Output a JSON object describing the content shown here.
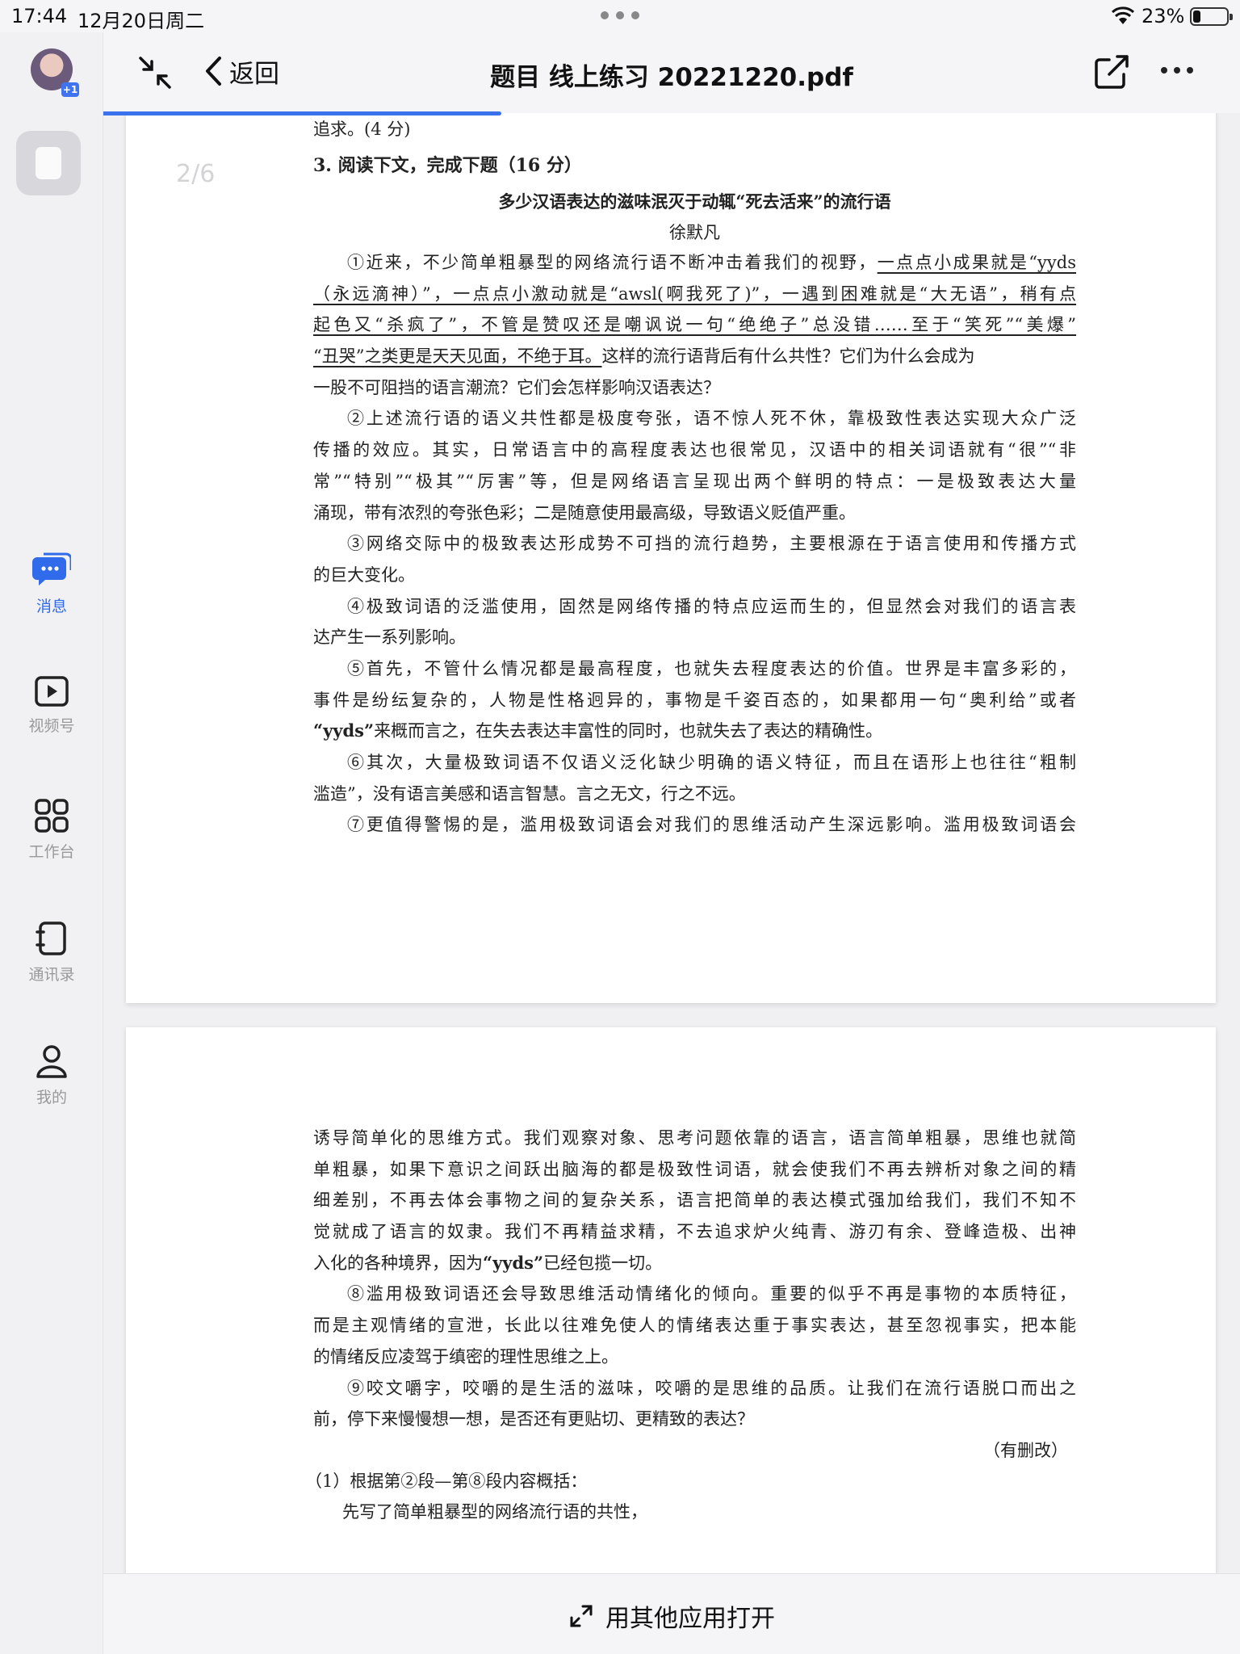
{
  "status_bar": {
    "time": "17:44",
    "date": "12月20日周二",
    "battery_percent": "23%",
    "battery_level": 0.23
  },
  "sidebar": {
    "avatar_badge": "+1",
    "items": [
      {
        "label": "消息",
        "icon": "chat-bubble-icon",
        "active": true
      },
      {
        "label": "视频号",
        "icon": "video-play-icon",
        "active": false
      },
      {
        "label": "工作台",
        "icon": "grid-apps-icon",
        "active": false
      },
      {
        "label": "通讯录",
        "icon": "contacts-book-icon",
        "active": false
      },
      {
        "label": "我的",
        "icon": "person-icon",
        "active": false
      }
    ]
  },
  "header": {
    "back_label": "返回",
    "title": "题目 线上练习 20221220.pdf"
  },
  "viewer": {
    "page_indicator": "2/6",
    "read_progress": 0.35
  },
  "document": {
    "prev_tail": "追求。(4 分)",
    "question_head": "3. 阅读下文，完成下题（16 分）",
    "article_title": "多少汉语表达的滋味泯灭于动辄“死去活来”的流行语",
    "author": "徐默凡",
    "p1": [
      "①近来，不少简单粗暴型的网络流行语不断冲击着我们的视野，",
      "一点点小成果就是“yyds",
      "（永远滴神）”，一点点小激动就是“awsl(啊我死了)”，一遇到困难就是“大无语”，稍有点",
      "起色又“杀疯了”，不管是赞叹还是嘲讽说一句“绝绝子”总没错……至于“笑死”“美爆”",
      "“丑哭”之类更是天天见面，不绝于耳。",
      "这样的流行语背后有什么共性？它们为什么会成为",
      "一股不可阻挡的语言潮流？它们会怎样影响汉语表达？"
    ],
    "p2": [
      "②上述流行语的语义共性都是极度夸张，语不惊人死不休，靠极致性表达实现大众广泛",
      "传播的效应。其实，日常语言中的高程度表达也很常见，汉语中的相关词语就有“很”“非",
      "常”“特别”“极其”“厉害”等，但是网络语言呈现出两个鲜明的特点：一是极致表达大量",
      "涌现，带有浓烈的夸张色彩；二是随意使用最高级，导致语义贬值严重。"
    ],
    "p3": [
      "③网络交际中的极致表达形成势不可挡的流行趋势，主要根源在于语言使用和传播方式",
      "的巨大变化。"
    ],
    "p4": [
      "④极致词语的泛滥使用，固然是网络传播的特点应运而生的，但显然会对我们的语言表",
      "达产生一系列影响。"
    ],
    "p5": [
      "⑤首先，不管什么情况都是最高程度，也就失去程度表达的价值。世界是丰富多彩的，",
      "事件是纷纭复杂的，人物是性格迥异的，事物是千姿百态的，如果都用一句“奥利给”或者",
      "“yyds”",
      "来概而言之，在失去表达丰富性的同时，也就失去了表达的精确性。"
    ],
    "p6": [
      "⑥其次，大量极致词语不仅语义泛化缺少明确的语义特征，而且在语形上也往往“粗制",
      "滥造”，没有语言美感和语言智慧。言之无文，行之不远。"
    ],
    "p7_start": "⑦更值得警惕的是，滥用极致词语会对我们的思维活动产生深远影响。滥用极致词语会",
    "p7_cont": [
      "诱导简单化的思维方式。我们观察对象、思考问题依靠的语言，语言简单粗暴，思维也就简",
      "单粗暴，如果下意识之间跃出脑海的都是极致性词语，就会使我们不再去辨析对象之间的精",
      "细差别，不再去体会事物之间的复杂关系，语言把简单的表达模式强加给我们，我们不知不",
      "觉就成了语言的奴隶。我们不再精益求精，不去追求炉火纯青、游刃有余、登峰造极、出神",
      "入化的各种境界，因为",
      "“yyds”",
      "已经包揽一切。"
    ],
    "p8": [
      "⑧滥用极致词语还会导致思维活动情绪化的倾向。重要的似乎不再是事物的本质特征，",
      "而是主观情绪的宣泄，长此以往难免使人的情绪表达重于事实表达，甚至忽视事实，把本能",
      "的情绪反应凌驾于缜密的理性思维之上。"
    ],
    "p9": [
      "⑨咬文嚼字，咬嚼的是生活的滋味，咬嚼的是思维的品质。让我们在流行语脱口而出之",
      "前，停下来慢慢想一想，是否还有更贴切、更精致的表达？"
    ],
    "note": "（有删改）",
    "sub_q1": "（1）根据第②段—第⑧段内容概括：",
    "sub_q1_line1": "先写了简单粗暴型的网络流行语的共性，"
  },
  "bottom_bar": {
    "open_with_label": "用其他应用打开"
  }
}
